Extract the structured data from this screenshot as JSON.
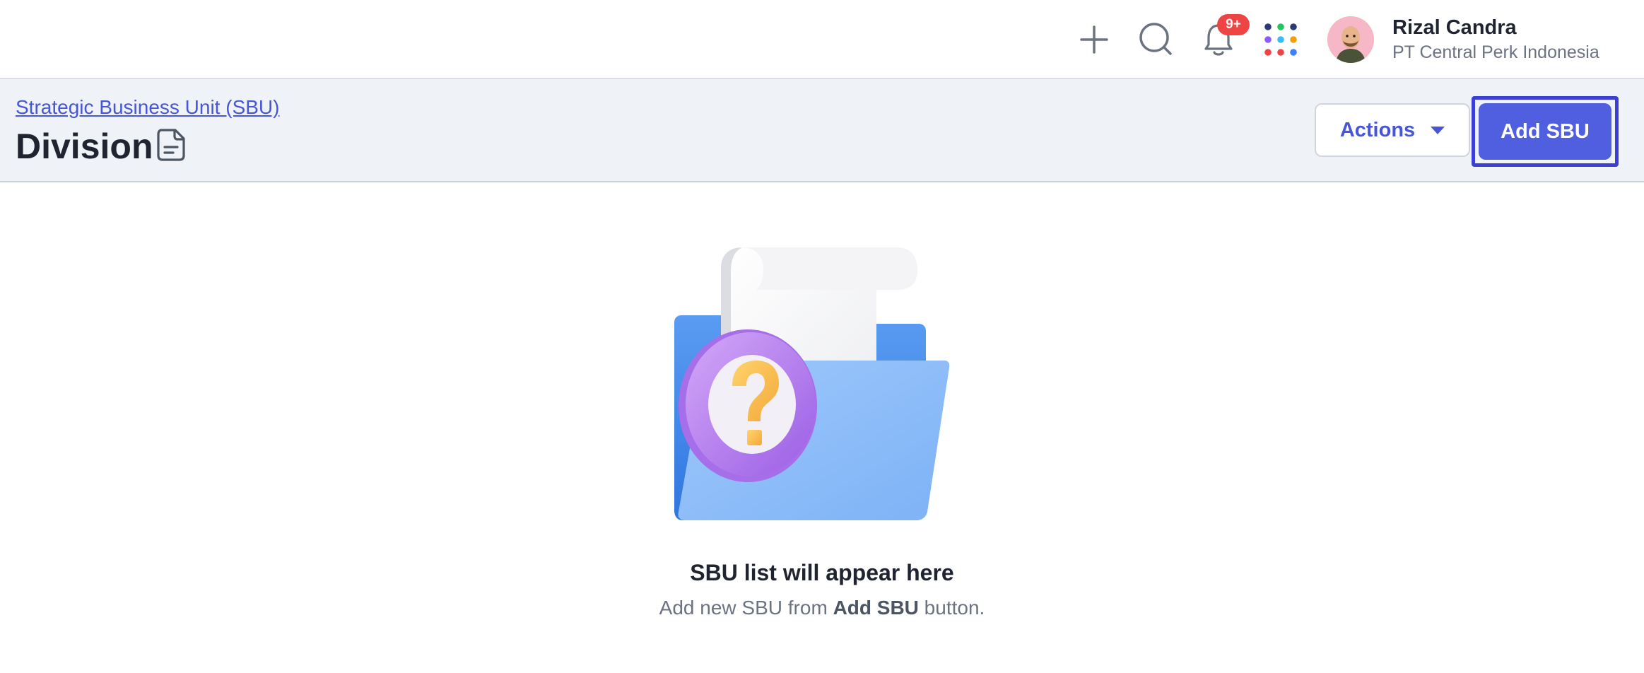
{
  "topbar": {
    "notifications_badge": "9+",
    "user": {
      "name": "Rizal Candra",
      "company": "PT Central Perk Indonesia"
    },
    "icons": [
      "plus-icon",
      "search-icon",
      "bell-icon",
      "apps-grid-icon"
    ],
    "app_dot_colors": [
      "#2c3a77",
      "#22c55e",
      "#2c3a77",
      "#8b5cf6",
      "#38bdf8",
      "#f59e0b",
      "#ef4444",
      "#ef4444",
      "#3b82f6"
    ]
  },
  "header": {
    "breadcrumb": "Strategic Business Unit (SBU)",
    "title": "Division",
    "actions_label": "Actions",
    "add_label": "Add SBU"
  },
  "empty_state": {
    "title": "SBU list will appear here",
    "subtitle_prefix": "Add new SBU from",
    "subtitle_bold": "Add SBU",
    "subtitle_suffix": "button."
  },
  "colors": {
    "primary": "#4f5fe0",
    "link": "#4656d6",
    "badge": "#ef4444",
    "header_bg": "#eff2f7"
  }
}
